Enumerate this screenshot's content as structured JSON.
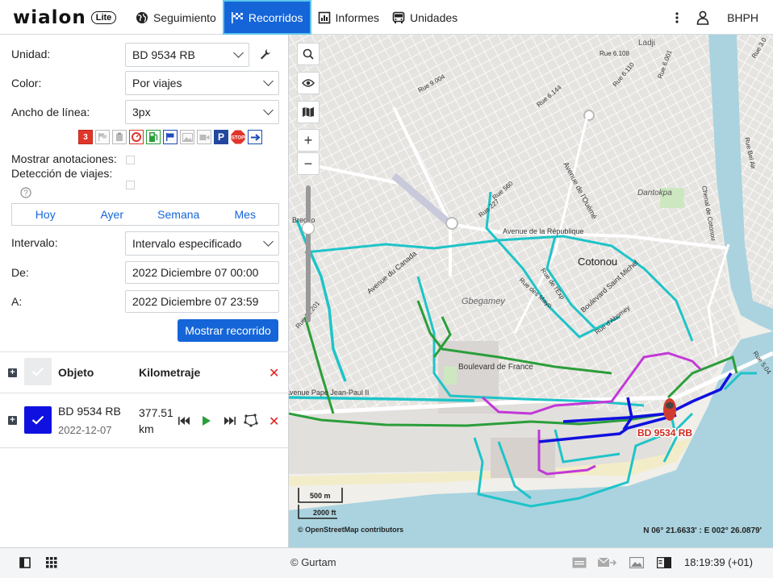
{
  "app": {
    "logo": "wialon",
    "logo_badge": "Lite"
  },
  "nav": [
    {
      "label": "Seguimiento",
      "icon": "globe-icon"
    },
    {
      "label": "Recorridos",
      "icon": "checkered-flag-icon"
    },
    {
      "label": "Informes",
      "icon": "report-icon"
    },
    {
      "label": "Unidades",
      "icon": "bus-icon"
    }
  ],
  "user": "BHPH",
  "form": {
    "unit_label": "Unidad:",
    "unit_value": "BD 9534 RB",
    "color_label": "Color:",
    "color_value": "Por viajes",
    "width_label": "Ancho de línea:",
    "width_value": "3px",
    "annotations_label": "Mostrar anotaciones:",
    "trips_label": "Detección de viajes:",
    "interval_label": "Intervalo:",
    "interval_value": "Intervalo especificado",
    "from_label": "De:",
    "from_value": "2022 Diciembre 07 00:00",
    "to_label": "A:",
    "to_value": "2022 Diciembre 07 23:59",
    "show_button": "Mostrar recorrido",
    "event_badge": "3",
    "parking_badge": "P",
    "stop_badge": "STOP"
  },
  "periods": [
    "Hoy",
    "Ayer",
    "Semana",
    "Mes"
  ],
  "table": {
    "col_object": "Objeto",
    "col_mileage": "Kilometraje",
    "row": {
      "name": "BD 9534 RB",
      "date": "2022-12-07",
      "km_value": "377.51",
      "km_unit": "km"
    }
  },
  "map": {
    "unit_label": "BD 9534 RB",
    "scale_m": "500 m",
    "scale_ft": "2000 ft",
    "attribution": "© OpenStreetMap contributors",
    "coords": "N 06° 21.6633' : E 002° 26.0879'",
    "places": {
      "ladji": "Ladji",
      "cotonou": "Cotonou",
      "dantokpa": "Dantokpa",
      "gbegamey": "Gbegamey",
      "r6108": "Rue 6.108",
      "r6001": "Rue 6.001",
      "r9004": "Rue 9.004",
      "r6110": "Rue 6.110",
      "r6144": "Rue 6.144",
      "r560": "Rue 560",
      "r227": "Rue 227",
      "r12201": "Rue 12.201",
      "r5041": "Rue 5.04",
      "r3": "Rue 3.0",
      "av_ouemé": "Avenue de l'Ouémé",
      "av_rep": "Avenue de la République",
      "av_canada": "Avenue du Canada",
      "bd_st_michel": "Boulevard Saint Michel",
      "rue_mayo": "Rue des Mayo",
      "rue_dabomey": "Rue d'Abomey",
      "rue_dix": "Rue de l'Exp",
      "bd_france": "Boulevard de France",
      "av_jp2": "Avenue Pape Jean-Paul II",
      "chenal": "Chenal de Cotonou",
      "rue_bel_air": "Rue Bel Air",
      "brecho": "Brecho"
    }
  },
  "footer": {
    "copyright": "© Gurtam",
    "clock": "18:19:39 (+01)"
  }
}
